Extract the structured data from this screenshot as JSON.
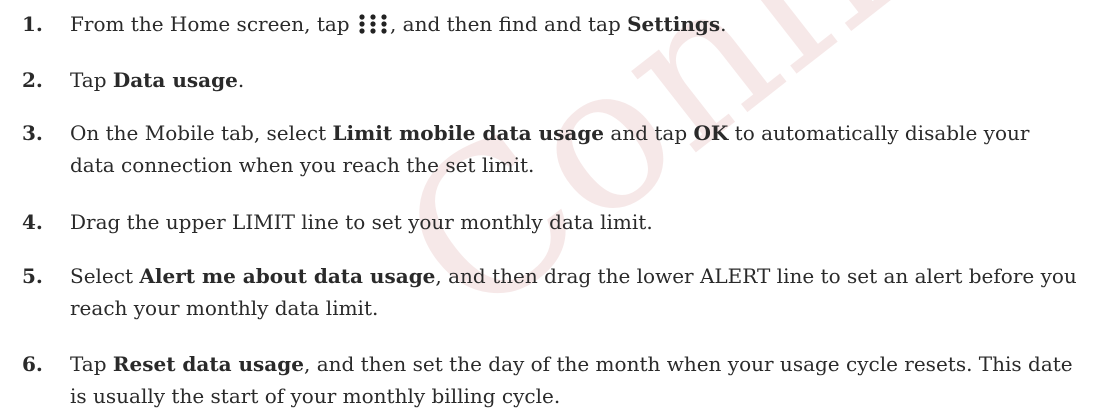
{
  "watermark": "Confidential",
  "steps": [
    {
      "number": "1.",
      "parts": [
        "From the Home screen, tap ",
        "",
        ", and then find and tap ",
        "Settings",
        "."
      ],
      "icon": "apps-grid-icon"
    },
    {
      "number": "2.",
      "parts": [
        "Tap ",
        "Data usage",
        "."
      ]
    },
    {
      "number": "3.",
      "parts": [
        "On the Mobile tab, select ",
        "Limit mobile data usage",
        " and tap ",
        "OK",
        " to automatically disable your data connection when you reach the set limit."
      ]
    },
    {
      "number": "4.",
      "parts": [
        "Drag the upper LIMIT line to set your monthly data limit."
      ]
    },
    {
      "number": "5.",
      "parts": [
        "Select ",
        "Alert me about data usage",
        ", and then drag the lower ALERT line to set an alert before you reach your monthly data limit."
      ]
    },
    {
      "number": "6.",
      "parts": [
        "Tap ",
        "Reset data usage",
        ", and then set the day of the month when your usage cycle resets. This date is usually the start of your monthly billing cycle."
      ]
    }
  ]
}
